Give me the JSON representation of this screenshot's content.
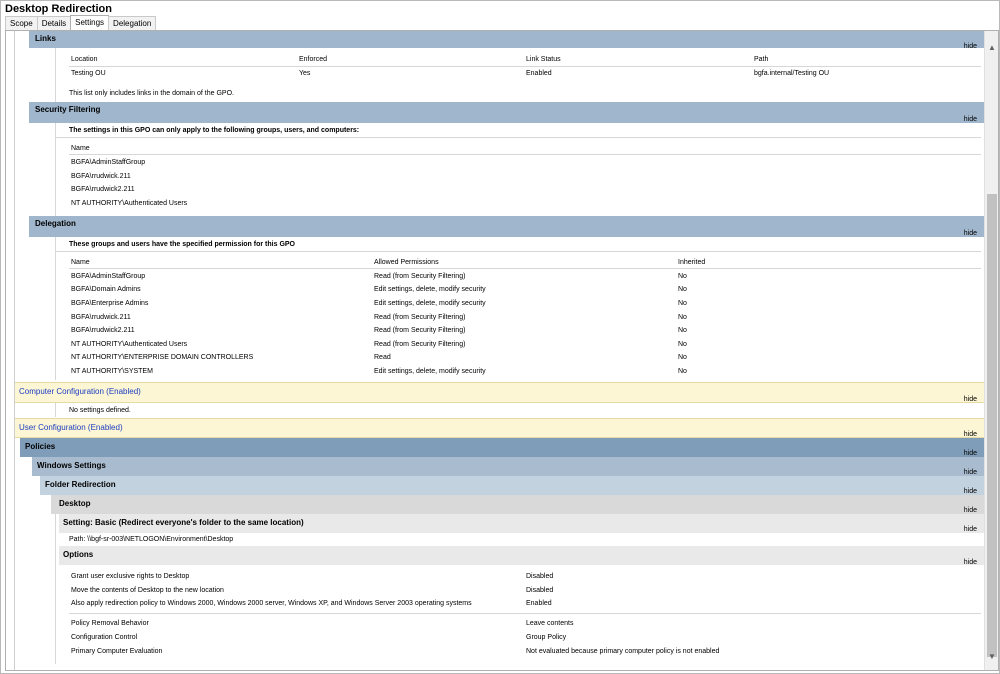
{
  "window": {
    "title": "Desktop Redirection"
  },
  "tabs": [
    "Scope",
    "Details",
    "Settings",
    "Delegation"
  ],
  "hide_label": "hide",
  "links": {
    "title": "Links",
    "columns": [
      "Location",
      "Enforced",
      "Link Status",
      "Path"
    ],
    "rows": [
      [
        "Testing OU",
        "Yes",
        "Enabled",
        "bgfa.internal/Testing OU"
      ]
    ],
    "note": "This list only includes links in the domain of the GPO."
  },
  "security_filtering": {
    "title": "Security Filtering",
    "heading": "The settings in this GPO can only apply to the following groups, users, and computers:",
    "column": "Name",
    "items": [
      "BGFA\\AdminStaffGroup",
      "BGFA\\rrudwick.211",
      "BGFA\\rrudwick2.211",
      "NT AUTHORITY\\Authenticated Users"
    ]
  },
  "delegation": {
    "title": "Delegation",
    "heading": "These groups and users have the specified permission for this GPO",
    "columns": [
      "Name",
      "Allowed Permissions",
      "Inherited"
    ],
    "rows": [
      [
        "BGFA\\AdminStaffGroup",
        "Read (from Security Filtering)",
        "No"
      ],
      [
        "BGFA\\Domain Admins",
        "Edit settings, delete, modify security",
        "No"
      ],
      [
        "BGFA\\Enterprise Admins",
        "Edit settings, delete, modify security",
        "No"
      ],
      [
        "BGFA\\rrudwick.211",
        "Read (from Security Filtering)",
        "No"
      ],
      [
        "BGFA\\rrudwick2.211",
        "Read (from Security Filtering)",
        "No"
      ],
      [
        "NT AUTHORITY\\Authenticated Users",
        "Read (from Security Filtering)",
        "No"
      ],
      [
        "NT AUTHORITY\\ENTERPRISE DOMAIN CONTROLLERS",
        "Read",
        "No"
      ],
      [
        "NT AUTHORITY\\SYSTEM",
        "Edit settings, delete, modify security",
        "No"
      ]
    ]
  },
  "computer_config": {
    "title": "Computer Configuration (Enabled)",
    "note": "No settings defined."
  },
  "user_config": {
    "title": "User Configuration (Enabled)",
    "policies": "Policies",
    "windows_settings": "Windows Settings",
    "folder_redirection": "Folder Redirection",
    "desktop": "Desktop",
    "setting": "Setting: Basic (Redirect everyone's folder to the same location)",
    "path": "Path: \\\\bgf-sr-003\\NETLOGON\\Environment\\Desktop",
    "options_title": "Options",
    "options": [
      [
        "Grant user exclusive rights to Desktop",
        "Disabled"
      ],
      [
        "Move the contents of Desktop to the new location",
        "Disabled"
      ],
      [
        "Also apply redirection policy to Windows 2000, Windows 2000 server, Windows XP, and Windows Server 2003 operating systems",
        "Enabled"
      ]
    ],
    "policy_options": [
      [
        "Policy Removal Behavior",
        "Leave contents"
      ],
      [
        "Configuration Control",
        "Group Policy"
      ],
      [
        "Primary Computer Evaluation",
        "Not evaluated because primary computer policy is not enabled"
      ]
    ]
  },
  "colors": {
    "section_bar": "#9fb6cc",
    "policies_bar": "#7f9db8",
    "config_bar": "#fdf6d5",
    "config_text": "#1a3cc0"
  }
}
